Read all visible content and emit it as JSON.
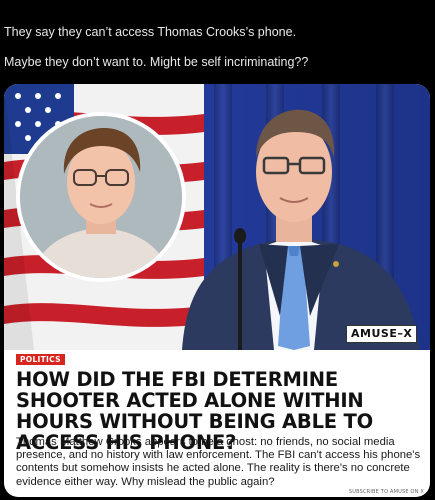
{
  "post": {
    "lines": [
      "They say they can’t access Thomas Crooks’s phone.",
      "Maybe they don’t want to.  Might be self incriminating??"
    ]
  },
  "media": {
    "logo_text": "AMUSE–X",
    "category_tag": "POLITICS",
    "headline": "HOW DID THE FBI DETERMINE SHOOTER ACTED ALONE WITHIN HOURS WITHOUT BEING ABLE TO ACCESS HIS PHONE?",
    "body": "Thomas Matthew Crooks appears to be a ghost: no friends, no social media presence, and no history with law enforcement. The FBI can't access his phone's contents but somehow insists he acted alone. The reality is there's no concrete evidence either way. Why mislead the public again?",
    "footer_text": "SUBSCRIBE TO AMUSE ON X"
  },
  "colors": {
    "page_bg": "#000000",
    "post_text": "#e7e9ea",
    "tag_red": "#d7261e",
    "backdrop_blue": "#233a9a"
  },
  "icons": [
    "american-flag",
    "inset-portrait",
    "speaker-portrait",
    "microphone"
  ]
}
